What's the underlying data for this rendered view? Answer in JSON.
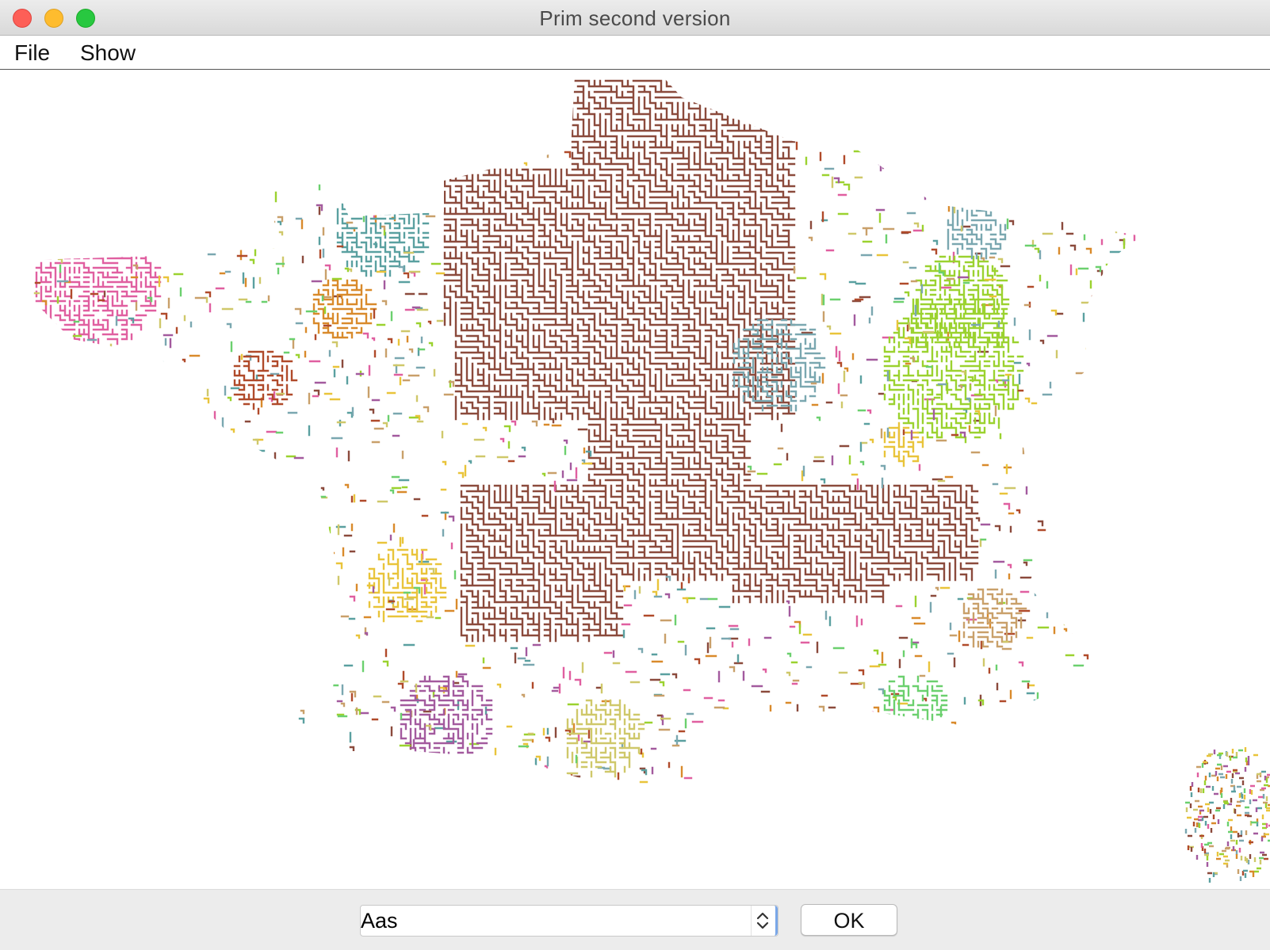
{
  "window": {
    "title": "Prim second version"
  },
  "menu": {
    "items": [
      {
        "label": "File"
      },
      {
        "label": "Show"
      }
    ]
  },
  "canvas": {
    "content": "minimum-spanning-tree map of France",
    "dominant_color": "#8b4a3c",
    "palette": [
      "#8b4a3c",
      "#e05fa0",
      "#d98a2b",
      "#9bd22f",
      "#e9c43a",
      "#7aa7b0",
      "#c9a06a",
      "#6bd06e",
      "#b04a2a",
      "#a35a9e",
      "#5aa0a0",
      "#cfc86a"
    ]
  },
  "search": {
    "value": "Aas",
    "ok_label": "OK"
  },
  "colors": {
    "titlebar": "#e3e3e3",
    "close": "#fd5f57",
    "minimize": "#febc2e",
    "zoom": "#28c840",
    "focus_ring": "#7aa7e8"
  }
}
